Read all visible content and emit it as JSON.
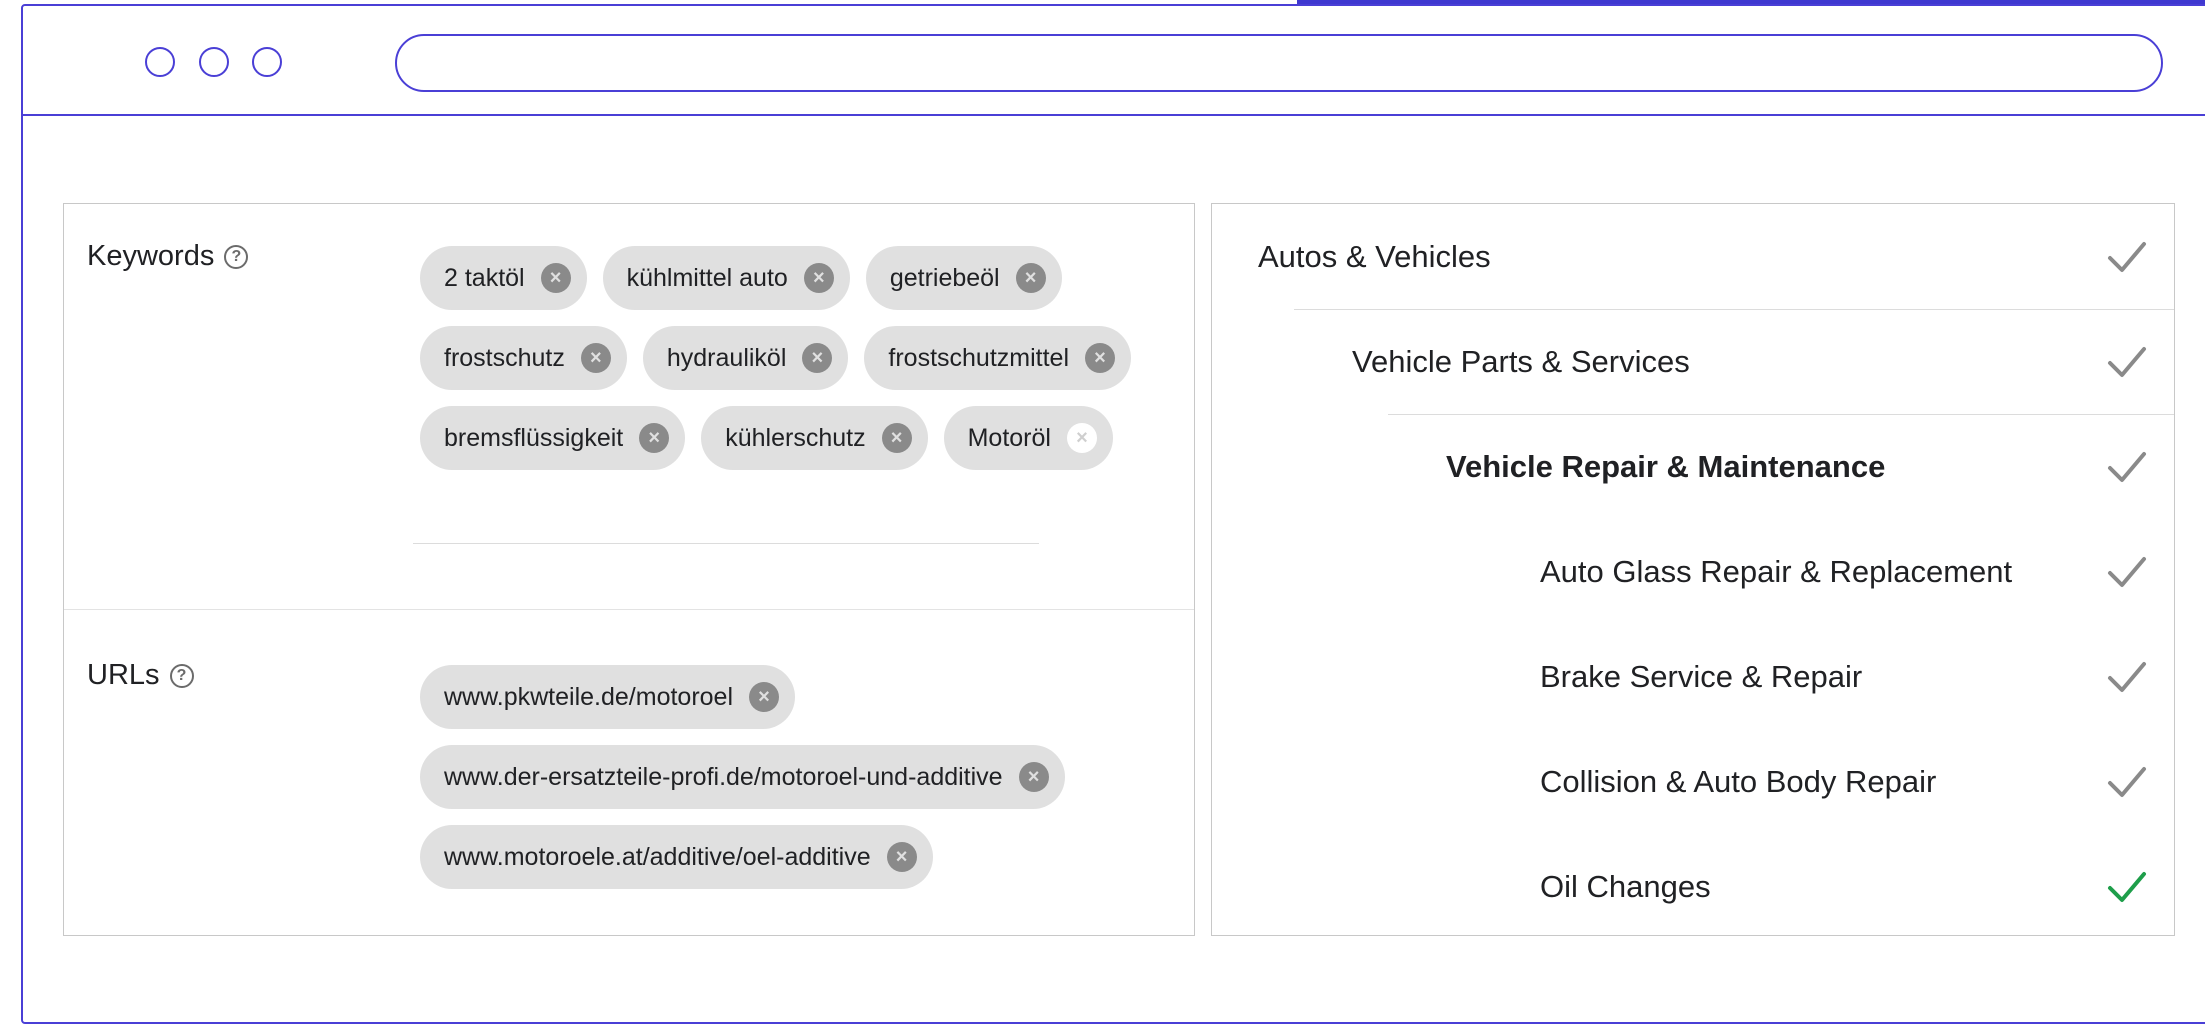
{
  "keywords": {
    "label": "Keywords",
    "help": "?",
    "chips": [
      [
        "2 taktöl",
        "kühlmittel auto",
        "getriebeöl"
      ],
      [
        "frostschutz",
        "hydrauliköl",
        "frostschutzmittel"
      ],
      [
        "bremsflüssigkeit",
        "kühlerschutz",
        "Motoröl"
      ]
    ]
  },
  "urls": {
    "label": "URLs",
    "help": "?",
    "chips": [
      "www.pkwteile.de/motoroel",
      "www.der-ersatzteile-profi.de/motoroel-und-additive",
      "www.motoroele.at/additive/oel-additive"
    ]
  },
  "categories": [
    {
      "label": "Autos & Vehicles",
      "bold": false,
      "check_color": "#8a8a8a"
    },
    {
      "label": "Vehicle Parts & Services",
      "bold": false,
      "check_color": "#8a8a8a"
    },
    {
      "label": "Vehicle Repair & Maintenance",
      "bold": true,
      "check_color": "#8a8a8a"
    },
    {
      "label": "Auto Glass Repair & Replacement",
      "bold": false,
      "check_color": "#8a8a8a"
    },
    {
      "label": "Brake Service & Repair",
      "bold": false,
      "check_color": "#8a8a8a"
    },
    {
      "label": "Collision & Auto Body Repair",
      "bold": false,
      "check_color": "#8a8a8a"
    },
    {
      "label": "Oil Changes",
      "bold": false,
      "check_color": "#1e9e4a"
    }
  ],
  "colors": {
    "accent": "#4a3fd6",
    "chip_bg": "#e0e0e0",
    "check_active": "#1e9e4a",
    "check_inactive": "#8a8a8a"
  },
  "icons": {
    "remove": "×",
    "check": "check-icon",
    "help": "help-circle-icon"
  }
}
